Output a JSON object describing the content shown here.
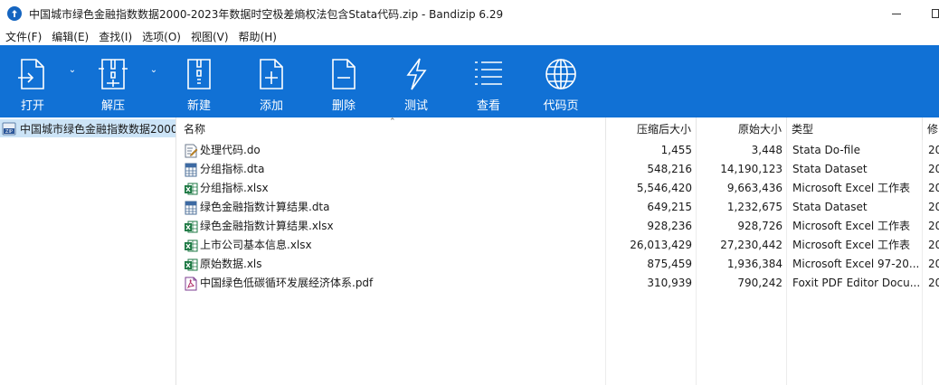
{
  "window": {
    "title": "中国城市绿色金融指数数据2000-2023年数据时空极差熵权法包含Stata代码.zip - Bandizip 6.29"
  },
  "menu": [
    "文件(F)",
    "编辑(E)",
    "查找(I)",
    "选项(O)",
    "视图(V)",
    "帮助(H)"
  ],
  "toolbar": {
    "buttons": [
      {
        "label": "打开",
        "icon": "open-icon"
      },
      {
        "label": "解压",
        "icon": "extract-icon"
      },
      {
        "label": "新建",
        "icon": "new-archive-icon"
      },
      {
        "label": "添加",
        "icon": "add-icon"
      },
      {
        "label": "删除",
        "icon": "delete-icon"
      },
      {
        "label": "测试",
        "icon": "test-icon"
      },
      {
        "label": "查看",
        "icon": "view-icon"
      },
      {
        "label": "代码页",
        "icon": "globe-icon"
      }
    ]
  },
  "tree": {
    "root_label": "中国城市绿色金融指数数据2000"
  },
  "columns": {
    "name": "名称",
    "compressed": "压缩后大小",
    "original": "原始大小",
    "type": "类型",
    "modified": "修"
  },
  "files": [
    {
      "name": "处理代码.do",
      "compressed": "1,455",
      "original": "3,448",
      "type": "Stata Do-file",
      "modified": "20",
      "icon": "stata-do-icon"
    },
    {
      "name": "分组指标.dta",
      "compressed": "548,216",
      "original": "14,190,123",
      "type": "Stata Dataset",
      "modified": "20",
      "icon": "stata-dataset-icon"
    },
    {
      "name": "分组指标.xlsx",
      "compressed": "5,546,420",
      "original": "9,663,436",
      "type": "Microsoft Excel 工作表",
      "modified": "20",
      "icon": "excel-icon"
    },
    {
      "name": "绿色金融指数计算结果.dta",
      "compressed": "649,215",
      "original": "1,232,675",
      "type": "Stata Dataset",
      "modified": "20",
      "icon": "stata-dataset-icon"
    },
    {
      "name": "绿色金融指数计算结果.xlsx",
      "compressed": "928,236",
      "original": "928,726",
      "type": "Microsoft Excel 工作表",
      "modified": "20",
      "icon": "excel-icon"
    },
    {
      "name": "上市公司基本信息.xlsx",
      "compressed": "26,013,429",
      "original": "27,230,442",
      "type": "Microsoft Excel 工作表",
      "modified": "20",
      "icon": "excel-icon"
    },
    {
      "name": "原始数据.xls",
      "compressed": "875,459",
      "original": "1,936,384",
      "type": "Microsoft Excel 97-20...",
      "modified": "20",
      "icon": "excel-icon"
    },
    {
      "name": "中国绿色低碳循环发展经济体系.pdf",
      "compressed": "310,939",
      "original": "790,242",
      "type": "Foxit PDF Editor Docu...",
      "modified": "20",
      "icon": "pdf-icon"
    }
  ],
  "colors": {
    "toolbar": "#1171d5",
    "selection": "#cce4f7"
  }
}
